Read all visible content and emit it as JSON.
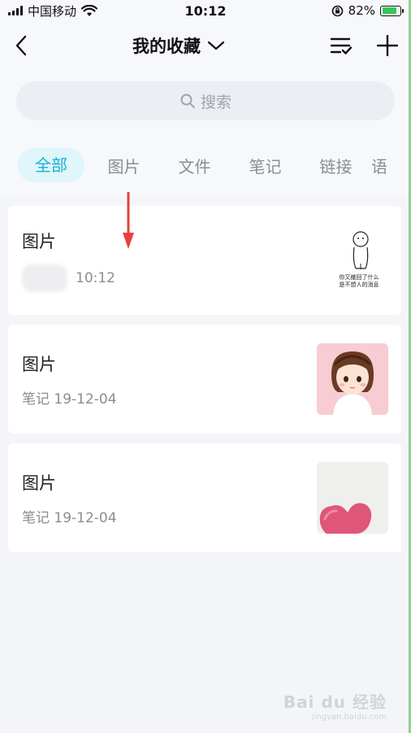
{
  "status_bar": {
    "carrier": "中国移动",
    "time": "10:12",
    "battery": "82%",
    "battery_level": 0.82
  },
  "nav": {
    "title": "我的收藏"
  },
  "search": {
    "placeholder": "搜索"
  },
  "tabs": [
    {
      "label": "全部",
      "active": true
    },
    {
      "label": "图片"
    },
    {
      "label": "文件"
    },
    {
      "label": "笔记"
    },
    {
      "label": "链接"
    },
    {
      "label": "语"
    }
  ],
  "items": [
    {
      "title": "图片",
      "meta": "10:12",
      "thumb_text_1": "你又撤回了什么",
      "thumb_text_2": "是不想人的消息"
    },
    {
      "title": "图片",
      "meta": "笔记 19-12-04"
    },
    {
      "title": "图片",
      "meta": "笔记 19-12-04"
    }
  ],
  "watermark": {
    "brand": "Bai du 经验",
    "url": "jingyan.baidu.com"
  },
  "colors": {
    "accent": "#1ab1d6",
    "active_tab_bg": "#dff6fb",
    "arrow": "#e8403a"
  }
}
